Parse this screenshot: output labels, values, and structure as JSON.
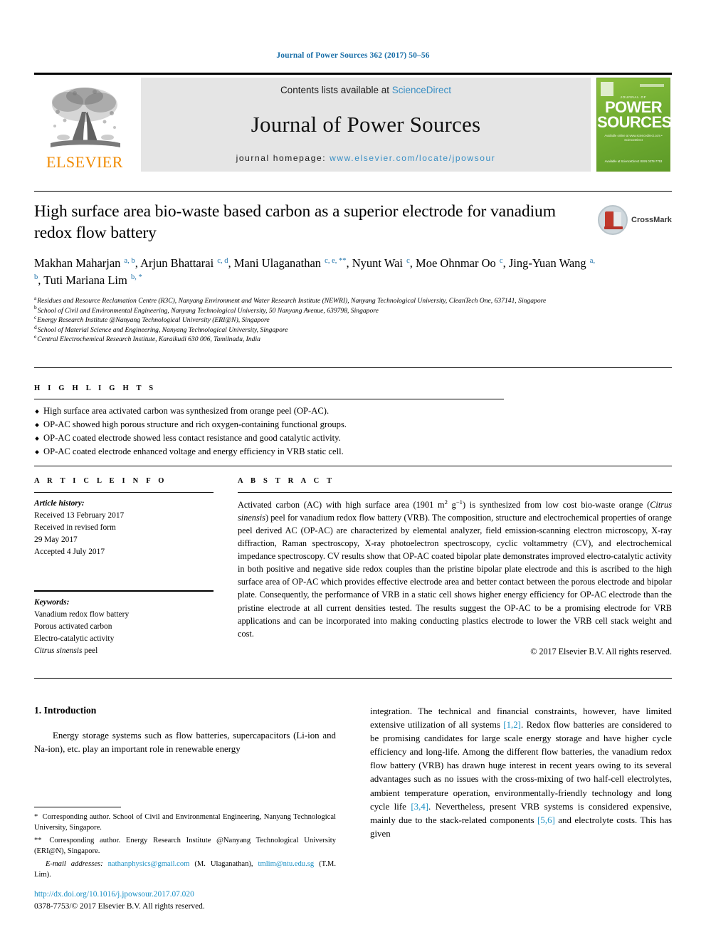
{
  "running_head": "Journal of Power Sources 362 (2017) 50–56",
  "masthead": {
    "contents_prefix": "Contents lists available at ",
    "sciencedirect": "ScienceDirect",
    "journal_name": "Journal of Power Sources",
    "homepage_label": "journal homepage: ",
    "homepage_url": "www.elsevier.com/locate/jpowsour",
    "publisher_logo_text": "ELSEVIER",
    "cover": {
      "eyebrow": "JOURNAL OF",
      "title_line1": "POWER",
      "title_line2": "SOURCES",
      "subtitle": "Available online at\nwww.sciencedirect.com  •  ScienceDirect",
      "footer": "Available at ScienceDirect\nISSN 0378-7753"
    },
    "accent_link_color": "#3a8fc4"
  },
  "crossmark": {
    "label": "CrossMark"
  },
  "article": {
    "title": "High surface area bio-waste based carbon as a superior electrode for vanadium redox flow battery",
    "authors": [
      {
        "name": "Makhan Maharjan",
        "marks": "a, b",
        "sep": ","
      },
      {
        "name": "Arjun Bhattarai",
        "marks": "c, d",
        "sep": ","
      },
      {
        "name": "Mani Ulaganathan",
        "marks": "c, e, **",
        "sep": ","
      },
      {
        "name": "Nyunt Wai",
        "marks": "c",
        "sep": ","
      },
      {
        "name": "Moe Ohnmar Oo",
        "marks": "c",
        "sep": ","
      },
      {
        "name": "Jing-Yuan Wang",
        "marks": "a, b",
        "sep": ","
      },
      {
        "name": "Tuti Mariana Lim",
        "marks": "b, *",
        "sep": ""
      }
    ],
    "affiliations": [
      {
        "mark": "a",
        "text": "Residues and Resource Reclamation Centre (R3C), Nanyang Environment and Water Research Institute (NEWRI), Nanyang Technological University, CleanTech One, 637141, Singapore"
      },
      {
        "mark": "b",
        "text": "School of Civil and Environmental Engineering, Nanyang Technological University, 50 Nanyang Avenue, 639798, Singapore"
      },
      {
        "mark": "c",
        "text": "Energy Research Institute @Nanyang Technological University (ERI@N), Singapore"
      },
      {
        "mark": "d",
        "text": "School of Material Science and Engineering, Nanyang Technological University, Singapore"
      },
      {
        "mark": "e",
        "text": "Central Electrochemical Research Institute, Karaikudi 630 006, Tamilnadu, India"
      }
    ]
  },
  "highlights": {
    "heading": "H I G H L I G H T S",
    "items": [
      "High surface area activated carbon was synthesized from orange peel (OP-AC).",
      "OP-AC showed high porous structure and rich oxygen-containing functional groups.",
      "OP-AC coated electrode showed less contact resistance and good catalytic activity.",
      "OP-AC coated electrode enhanced voltage and energy efficiency in VRB static cell."
    ]
  },
  "article_info": {
    "heading": "A R T I C L E   I N F O",
    "history_label": "Article history:",
    "history_lines": [
      "Received 13 February 2017",
      "Received in revised form",
      "29 May 2017",
      "Accepted 4 July 2017"
    ],
    "keywords_label": "Keywords:",
    "keywords": [
      "Vanadium redox flow battery",
      "Porous activated carbon",
      "Electro-catalytic activity",
      "Citrus sinensis peel"
    ]
  },
  "abstract": {
    "heading": "A B S T R A C T",
    "part1": "Activated carbon (AC) with high surface area (1901 m",
    "sup1": "2",
    "part2": " g",
    "sup2": "−1",
    "part3": ") is synthesized from low cost bio-waste orange (",
    "italic1": "Citrus sinensis",
    "part4": ") peel for vanadium redox flow battery (VRB). The composition, structure and electrochemical properties of orange peel derived AC (OP-AC) are characterized by elemental analyzer, field emission-scanning electron microscopy, X-ray diffraction, Raman spectroscopy, X-ray photoelectron spectroscopy, cyclic voltammetry (CV), and electrochemical impedance spectroscopy. CV results show that OP-AC coated bipolar plate demonstrates improved electro-catalytic activity in both positive and negative side redox couples than the pristine bipolar plate electrode and this is ascribed to the high surface area of OP-AC which provides effective electrode area and better contact between the porous electrode and bipolar plate. Consequently, the performance of VRB in a static cell shows higher energy efficiency for OP-AC electrode than the pristine electrode at all current densities tested. The results suggest the OP-AC to be a promising electrode for VRB applications and can be incorporated into making conducting plastics electrode to lower the VRB cell stack weight and cost.",
    "copyright": "© 2017 Elsevier B.V. All rights reserved."
  },
  "body": {
    "section_heading": "1. Introduction",
    "left_paragraph": "Energy storage systems such as flow batteries, supercapacitors (Li-ion and Na-ion), etc. play an important role in renewable energy",
    "right_pre_cite1": "integration. The technical and financial constraints, however, have limited extensive utilization of all systems ",
    "cite1": "[1,2]",
    "right_mid1": ". Redox flow batteries are considered to be promising candidates for large scale energy storage and have higher cycle efficiency and long-life. Among the different flow batteries, the vanadium redox flow battery (VRB) has drawn huge interest in recent years owing to its several advantages such as no issues with the cross-mixing of two half-cell electrolytes, ambient temperature operation, environmentally-friendly technology and long cycle life ",
    "cite2": "[3,4]",
    "right_mid2": ". Nevertheless, present VRB systems is considered expensive, mainly due to the stack-related components ",
    "cite3": "[5,6]",
    "right_end": " and electrolyte costs. This has given"
  },
  "footnotes": {
    "note1_star": "*",
    "note1": " Corresponding author. School of Civil and Environmental Engineering, Nanyang Technological University, Singapore.",
    "note2_star": "**",
    "note2": " Corresponding author. Energy Research Institute @Nanyang Technological University (ERI@N), Singapore.",
    "email_label": "E-mail addresses:",
    "email1": "nathanphysics@gmail.com",
    "email1_owner": " (M. Ulaganathan), ",
    "email2": "tmlim@ntu.edu.sg",
    "email2_owner": " (T.M. Lim)."
  },
  "doi": {
    "url": "http://dx.doi.org/10.1016/j.jpowsour.2017.07.020",
    "issn_line": "0378-7753/© 2017 Elsevier B.V. All rights reserved."
  }
}
